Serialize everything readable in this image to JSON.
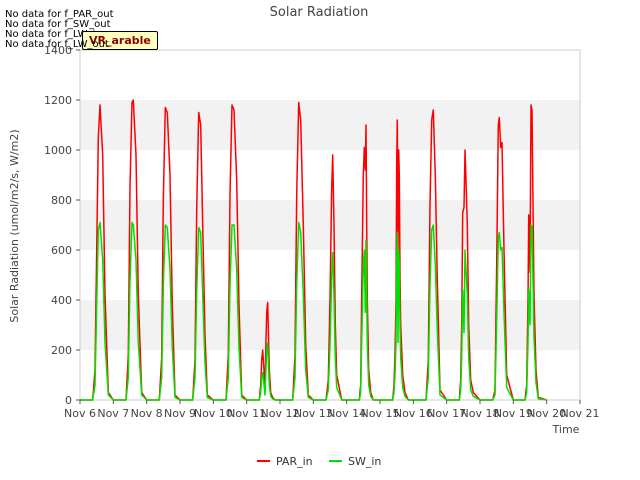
{
  "chart_data": {
    "type": "line",
    "title": "Solar Radiation",
    "xlabel": "Time",
    "ylabel": "Solar Radiation (umol/m2/s, W/m2)",
    "xlim": [
      6,
      21
    ],
    "ylim": [
      0,
      1400
    ],
    "x_ticks": [
      "Nov 6",
      "Nov 7",
      "Nov 8",
      "Nov 9",
      "Nov 10",
      "Nov 11",
      "Nov 12",
      "Nov 13",
      "Nov 14",
      "Nov 15",
      "Nov 16",
      "Nov 17",
      "Nov 18",
      "Nov 19",
      "Nov 20",
      "Nov 21"
    ],
    "y_ticks": [
      0,
      200,
      400,
      600,
      800,
      1000,
      1200,
      1400
    ],
    "grid": "horizontal bands",
    "legend_position": "bottom-center",
    "series": [
      {
        "name": "PAR_in",
        "color": "#ff0000",
        "x": [
          6.0,
          6.38,
          6.45,
          6.5,
          6.55,
          6.6,
          6.68,
          6.75,
          6.85,
          7.0,
          7.38,
          7.45,
          7.5,
          7.56,
          7.6,
          7.68,
          7.75,
          7.85,
          8.0,
          8.38,
          8.45,
          8.5,
          8.56,
          8.62,
          8.7,
          8.77,
          8.85,
          9.0,
          9.38,
          9.45,
          9.5,
          9.56,
          9.62,
          9.68,
          9.75,
          9.82,
          10.0,
          10.38,
          10.45,
          10.5,
          10.56,
          10.62,
          10.7,
          10.77,
          10.85,
          11.0,
          11.38,
          11.42,
          11.45,
          11.48,
          11.52,
          11.55,
          11.58,
          11.6,
          11.63,
          11.68,
          11.72,
          11.78,
          11.85,
          12.0,
          12.38,
          12.45,
          12.5,
          12.56,
          12.62,
          12.7,
          12.77,
          12.85,
          13.0,
          13.38,
          13.45,
          13.5,
          13.55,
          13.58,
          13.62,
          13.66,
          13.7,
          13.76,
          13.85,
          14.0,
          14.38,
          14.42,
          14.45,
          14.5,
          14.53,
          14.56,
          14.58,
          14.6,
          14.62,
          14.66,
          14.72,
          14.8,
          15.0,
          15.38,
          15.42,
          15.45,
          15.48,
          15.5,
          15.52,
          15.54,
          15.56,
          15.58,
          15.6,
          15.62,
          15.68,
          15.75,
          15.85,
          16.0,
          16.38,
          16.45,
          16.5,
          16.55,
          16.6,
          16.66,
          16.72,
          16.8,
          17.0,
          17.38,
          17.42,
          17.45,
          17.48,
          17.52,
          17.55,
          17.58,
          17.62,
          17.66,
          17.72,
          17.8,
          18.0,
          18.38,
          18.45,
          18.5,
          18.55,
          18.58,
          18.62,
          18.66,
          18.72,
          18.8,
          19.0,
          19.35,
          19.4,
          19.44,
          19.46,
          19.5,
          19.53,
          19.56,
          19.58,
          19.62,
          19.68,
          19.75,
          20.0
        ],
        "y": [
          0,
          0,
          120,
          600,
          1050,
          1180,
          980,
          420,
          30,
          0,
          0,
          180,
          850,
          1190,
          1200,
          980,
          420,
          30,
          0,
          0,
          170,
          800,
          1170,
          1150,
          900,
          380,
          20,
          0,
          0,
          160,
          760,
          1150,
          1100,
          700,
          260,
          20,
          0,
          0,
          180,
          820,
          1180,
          1160,
          880,
          380,
          20,
          0,
          0,
          60,
          160,
          200,
          120,
          40,
          240,
          350,
          390,
          120,
          30,
          10,
          0,
          0,
          0,
          180,
          820,
          1190,
          1120,
          700,
          220,
          20,
          0,
          0,
          80,
          400,
          850,
          980,
          700,
          300,
          100,
          60,
          0,
          0,
          0,
          60,
          420,
          900,
          1010,
          920,
          1100,
          700,
          400,
          120,
          30,
          0,
          0,
          0,
          60,
          180,
          400,
          950,
          1120,
          600,
          1000,
          900,
          500,
          300,
          100,
          30,
          0,
          0,
          0,
          160,
          780,
          1120,
          1160,
          900,
          480,
          40,
          0,
          0,
          80,
          300,
          750,
          770,
          1000,
          880,
          700,
          300,
          80,
          30,
          0,
          0,
          40,
          550,
          1100,
          1130,
          1010,
          1030,
          600,
          100,
          0,
          0,
          60,
          400,
          740,
          510,
          1180,
          1160,
          900,
          420,
          120,
          10,
          0
        ]
      },
      {
        "name": "SW_in",
        "color": "#00e000",
        "x": [
          6.0,
          6.38,
          6.45,
          6.5,
          6.55,
          6.6,
          6.68,
          6.75,
          6.85,
          7.0,
          7.38,
          7.45,
          7.5,
          7.56,
          7.6,
          7.68,
          7.75,
          7.85,
          8.0,
          8.38,
          8.45,
          8.5,
          8.56,
          8.62,
          8.7,
          8.77,
          8.85,
          9.0,
          9.38,
          9.45,
          9.5,
          9.56,
          9.62,
          9.68,
          9.75,
          9.82,
          10.0,
          10.38,
          10.45,
          10.5,
          10.56,
          10.62,
          10.7,
          10.77,
          10.85,
          11.0,
          11.38,
          11.42,
          11.45,
          11.48,
          11.52,
          11.55,
          11.58,
          11.6,
          11.63,
          11.68,
          11.72,
          11.78,
          11.85,
          12.0,
          12.38,
          12.45,
          12.5,
          12.56,
          12.62,
          12.7,
          12.77,
          12.85,
          13.0,
          13.38,
          13.45,
          13.5,
          13.55,
          13.58,
          13.62,
          13.66,
          13.7,
          13.76,
          13.85,
          14.0,
          14.38,
          14.42,
          14.45,
          14.5,
          14.53,
          14.56,
          14.58,
          14.6,
          14.62,
          14.66,
          14.72,
          14.8,
          15.0,
          15.38,
          15.42,
          15.45,
          15.48,
          15.5,
          15.52,
          15.54,
          15.56,
          15.58,
          15.6,
          15.62,
          15.68,
          15.75,
          15.85,
          16.0,
          16.38,
          16.45,
          16.5,
          16.55,
          16.6,
          16.66,
          16.72,
          16.8,
          17.0,
          17.38,
          17.42,
          17.45,
          17.48,
          17.52,
          17.55,
          17.58,
          17.62,
          17.66,
          17.72,
          17.8,
          18.0,
          18.38,
          18.45,
          18.5,
          18.55,
          18.58,
          18.62,
          18.66,
          18.72,
          18.8,
          19.0,
          19.35,
          19.4,
          19.44,
          19.46,
          19.5,
          19.53,
          19.56,
          19.58,
          19.62,
          19.68,
          19.75,
          20.0
        ],
        "y": [
          0,
          0,
          60,
          380,
          680,
          710,
          560,
          230,
          20,
          0,
          0,
          90,
          480,
          710,
          700,
          560,
          230,
          20,
          0,
          0,
          90,
          450,
          700,
          690,
          520,
          210,
          10,
          0,
          0,
          90,
          430,
          690,
          670,
          420,
          150,
          10,
          0,
          0,
          90,
          460,
          700,
          700,
          520,
          210,
          10,
          0,
          0,
          30,
          90,
          110,
          60,
          20,
          130,
          200,
          230,
          60,
          15,
          5,
          0,
          0,
          0,
          90,
          460,
          710,
          670,
          420,
          120,
          10,
          0,
          0,
          40,
          220,
          500,
          590,
          420,
          170,
          50,
          30,
          0,
          0,
          0,
          30,
          240,
          540,
          600,
          350,
          640,
          420,
          230,
          60,
          15,
          0,
          0,
          0,
          30,
          100,
          230,
          560,
          670,
          230,
          600,
          540,
          300,
          170,
          50,
          15,
          0,
          0,
          0,
          90,
          460,
          680,
          700,
          540,
          280,
          20,
          0,
          0,
          40,
          170,
          440,
          270,
          600,
          520,
          420,
          170,
          40,
          15,
          0,
          0,
          20,
          320,
          650,
          670,
          600,
          610,
          350,
          50,
          0,
          0,
          30,
          230,
          440,
          300,
          700,
          690,
          540,
          250,
          70,
          5,
          0
        ]
      }
    ]
  },
  "header": {
    "warnings": [
      "No data for f_PAR_out",
      "No data for f_SW_out",
      "No data for f_LW_in",
      "No data for f_LW_out"
    ],
    "badge": "VR_arable"
  }
}
